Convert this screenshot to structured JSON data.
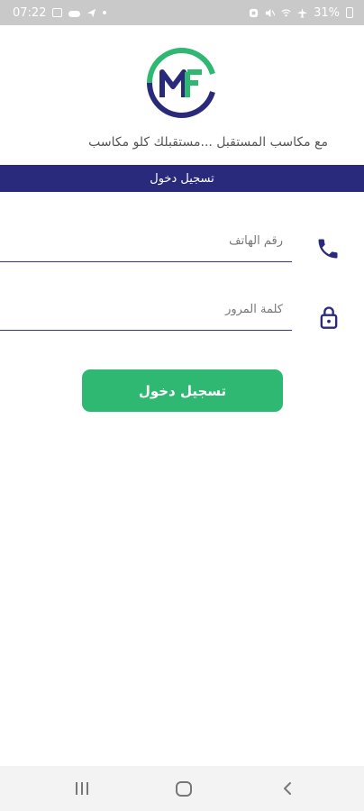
{
  "status_bar": {
    "time": "07:22",
    "battery": "31%",
    "icons": [
      "gallery-icon",
      "cloud-icon",
      "telegram-icon",
      "dot-icon",
      "alarm-icon",
      "mute-icon",
      "wifi-icon",
      "airplane-icon",
      "battery-icon"
    ]
  },
  "logo": {
    "letters": "MF",
    "colors": {
      "green": "#2fb872",
      "navy": "#2a2a7c"
    }
  },
  "tagline": "مع مكاسب المستقبل ...مستقبلك كلو مكاسب",
  "banner": {
    "title": "تسجيل دخول"
  },
  "form": {
    "phone_placeholder": "رقم الهاتف",
    "password_placeholder": "كلمة المرور",
    "login_label": "تسجيل دخول"
  },
  "nav": {
    "items": [
      "recents",
      "home",
      "back"
    ]
  },
  "colors": {
    "accent": "#2fb872",
    "primary": "#2a2a7c",
    "statusbar": "#c9c9c9"
  }
}
